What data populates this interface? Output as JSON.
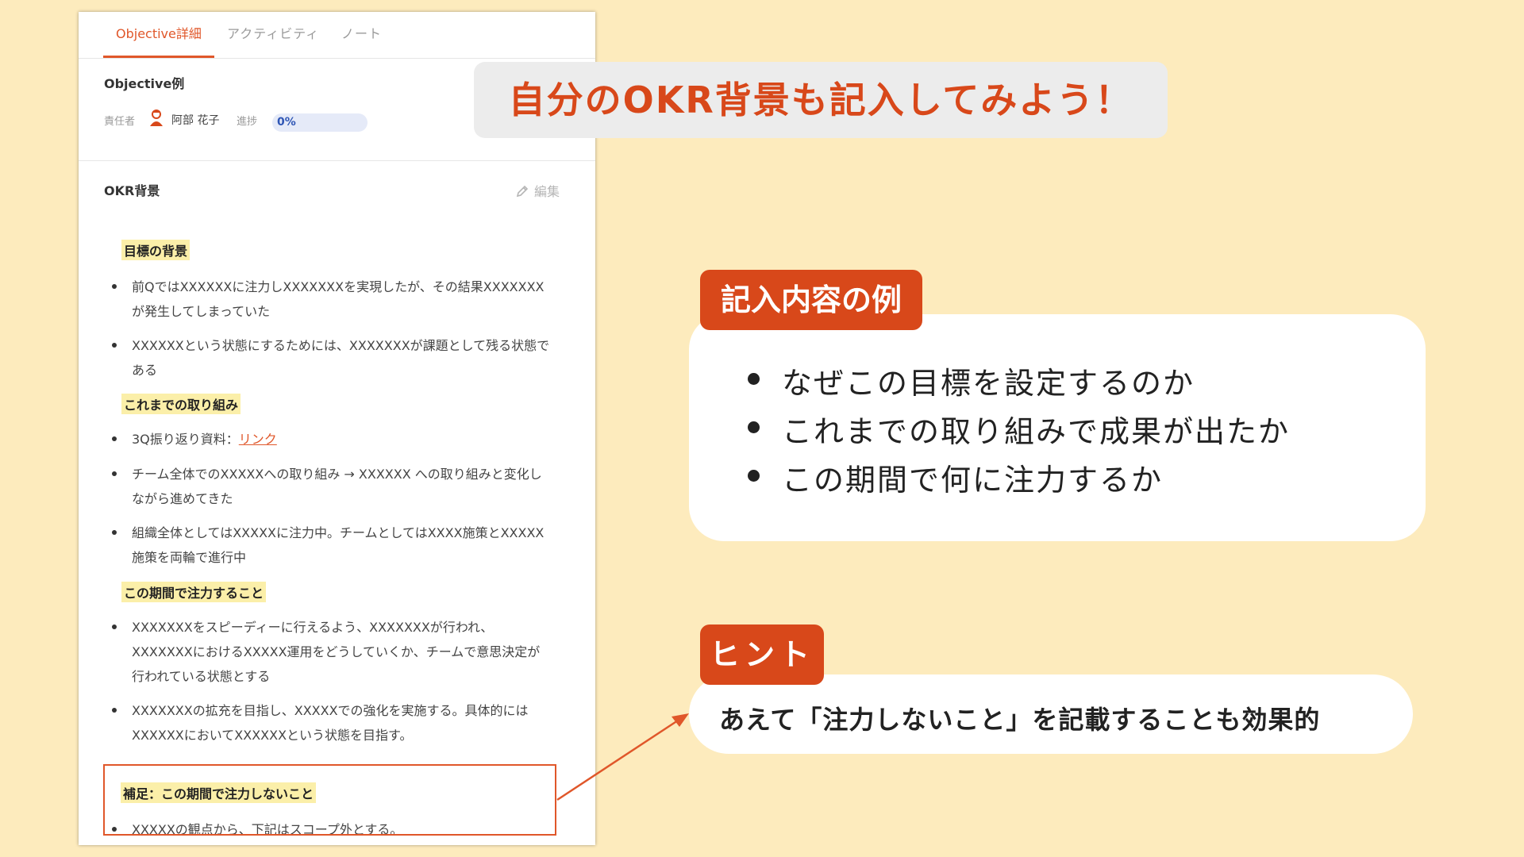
{
  "panel": {
    "tabs": [
      "Objective詳細",
      "アクティビティ",
      "ノート"
    ],
    "objective_title": "Objective例",
    "owner_label": "責任者",
    "owner_name": "阿部 花子",
    "progress_label": "進捗",
    "progress_value": "0%",
    "progress_fraction": 0,
    "background_title": "OKR背景",
    "edit_label": "編集",
    "sections": {
      "goal_heading": "目標の背景",
      "goal_bullet_1": "前QではXXXXXXに注力しXXXXXXXを実現したが、その結果XXXXXXXが発生してしまっていた",
      "goal_bullet_2": "XXXXXXという状態にするためには、XXXXXXXが課題として残る状態である",
      "prior_heading": "これまでの取り組み",
      "prior_bullet_1_prefix": "3Q振り返り資料：",
      "prior_bullet_1_link": "リンク",
      "prior_bullet_2": "チーム全体でのXXXXXへの取り組み → XXXXXX への取り組みと変化しながら進めてきた",
      "prior_bullet_3": "組織全体としてはXXXXXに注力中。チームとしてはXXXX施策とXXXXX施策を両輪で進行中",
      "focus_heading": "この期間で注力すること",
      "focus_bullet_1": "XXXXXXXをスピーディーに行えるよう、XXXXXXXが行われ、XXXXXXXにおけるXXXXX運用をどうしていくか、チームで意思決定が行われている状態とする",
      "focus_bullet_2": "XXXXXXXの拡充を目指し、XXXXXでの強化を実施する。具体的にはXXXXXXにおいてXXXXXXという状態を目指す。",
      "supplement_heading": "補足：この期間で注力しないこと",
      "supplement_bullet_1": "XXXXXの観点から、下記はスコープ外とする。"
    }
  },
  "main_title": "自分のOKR背景も記入してみよう！",
  "example": {
    "tag": "記入内容の例",
    "items": [
      "なぜこの目標を設定するのか",
      "これまでの取り組みで成果が出たか",
      "この期間で何に注力するか"
    ]
  },
  "hint": {
    "tag": "ヒント",
    "text": "あえて「注力しないこと」を記載することも効果的"
  },
  "colors": {
    "background": "#fdebbd",
    "accent": "#d8481a",
    "highlight": "#fbefa9",
    "progress_text": "#2f56b5"
  }
}
